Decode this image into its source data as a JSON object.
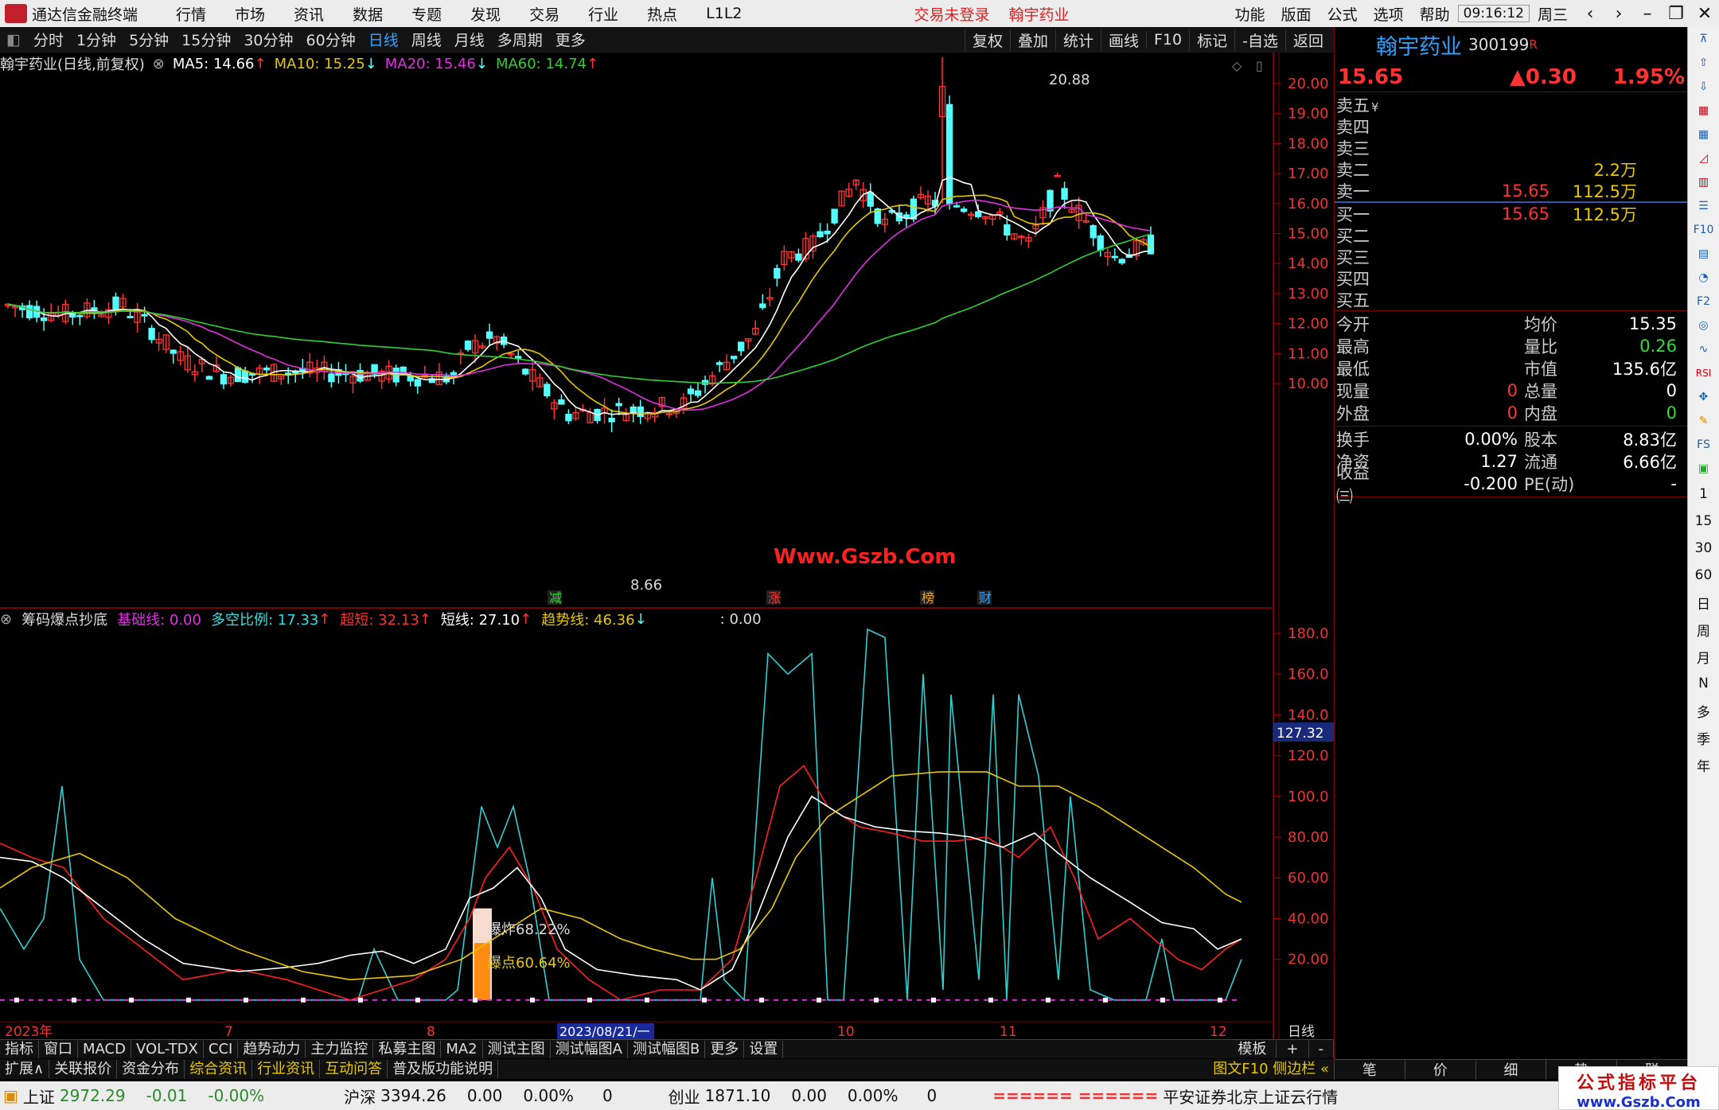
{
  "app": {
    "name": "通达信金融终端",
    "menus": [
      "行情",
      "市场",
      "资讯",
      "数据",
      "专题",
      "发现",
      "交易",
      "行业",
      "热点",
      "L1L2"
    ],
    "login_warn": "交易未登录",
    "title_stock": "翰宇药业",
    "rmenus": [
      "功能",
      "版面",
      "公式",
      "选项",
      "帮助"
    ],
    "time": "09:16:12",
    "weekday": "周三"
  },
  "periods": [
    "分时",
    "1分钟",
    "5分钟",
    "15分钟",
    "30分钟",
    "60分钟",
    "日线",
    "周线",
    "月线",
    "多周期",
    "更多"
  ],
  "selected_period": "日线",
  "toolbar_right": [
    "复权",
    "叠加",
    "统计",
    "画线",
    "F10",
    "标记",
    "-自选",
    "返回"
  ],
  "kline": {
    "title": "翰宇药业(日线,前复权)",
    "ma5": "MA5: 14.66",
    "ma10": "MA10: 15.25",
    "ma20": "MA20: 15.46",
    "ma60": "MA60: 14.74",
    "high_label": "20.88",
    "low_label": "8.66",
    "watermark": "Www.Gszb.Com",
    "markers": [
      "减",
      "涨",
      "榜",
      "财"
    ],
    "yticks": [
      "20.00",
      "19.00",
      "18.00",
      "17.00",
      "16.00",
      "15.00",
      "14.00",
      "13.00",
      "12.00",
      "11.00",
      "10.00"
    ]
  },
  "ind2": {
    "name": "筹码爆点抄底",
    "jcx": "基础线: 0.00",
    "dkbl": "多空比例: 17.33",
    "chd": "超短: 32.13",
    "dx": "短线: 27.10",
    "qsx": "趋势线: 46.36",
    "extra": ": 0.00",
    "label_a": "爆炸68.22%",
    "label_b": "爆点60.64%",
    "yticks": [
      "180.0",
      "160.0",
      "140.0",
      "120.0",
      "100.0",
      "80.00",
      "60.00",
      "40.00",
      "20.00"
    ],
    "cursor_val": "127.32"
  },
  "xaxis": {
    "year": "2023年",
    "m7": "7",
    "m8": "8",
    "m10": "10",
    "m11": "11",
    "m12": "12",
    "cursor_date": "2023/08/21/一",
    "period": "日线"
  },
  "tabs1": [
    "指标",
    "窗口",
    "MACD",
    "VOL-TDX",
    "CCI",
    "趋势动力",
    "主力监控",
    "私募主图",
    "MA2",
    "测试主图",
    "测试幅图A",
    "测试幅图B",
    "更多",
    "设置"
  ],
  "tabs1_right": [
    "模板",
    "+",
    "-"
  ],
  "tabs2": [
    "扩展∧",
    "关联报价",
    "资金分布",
    "综合资讯",
    "行业资讯",
    "互动问答",
    "普及版功能说明"
  ],
  "tabs2_right": "图文F10 侧边栏 «",
  "quote": {
    "name": "翰宇药业",
    "code": "300199",
    "r_mark": "R",
    "price": "15.65",
    "change": "▲0.30",
    "pct": "1.95%",
    "sells": [
      {
        "l": "卖五",
        "sym": "¥",
        "p": "",
        "v": ""
      },
      {
        "l": "卖四",
        "sym": "",
        "p": "",
        "v": ""
      },
      {
        "l": "卖三",
        "sym": "",
        "p": "",
        "v": ""
      },
      {
        "l": "卖二",
        "sym": "",
        "p": "",
        "v": "2.2万"
      },
      {
        "l": "卖一",
        "sym": "",
        "p": "15.65",
        "v": "112.5万"
      }
    ],
    "buys": [
      {
        "l": "买一",
        "p": "15.65",
        "v": "112.5万"
      },
      {
        "l": "买二",
        "p": "",
        "v": ""
      },
      {
        "l": "买三",
        "p": "",
        "v": ""
      },
      {
        "l": "买四",
        "p": "",
        "v": ""
      },
      {
        "l": "买五",
        "p": "",
        "v": ""
      }
    ],
    "stats1": [
      [
        "今开",
        "",
        "均价",
        "15.35"
      ],
      [
        "最高",
        "",
        "量比",
        "0.26"
      ],
      [
        "最低",
        "",
        "市值",
        "135.6亿"
      ],
      [
        "现量",
        "0",
        "总量",
        "0"
      ],
      [
        "外盘",
        "0",
        "内盘",
        "0"
      ]
    ],
    "stats2": [
      [
        "换手",
        "0.00%",
        "股本",
        "8.83亿"
      ],
      [
        "净资",
        "1.27",
        "流通",
        "6.66亿"
      ],
      [
        "收益㈢",
        "-0.200",
        "PE(动)",
        "-"
      ]
    ],
    "tabs": [
      "笔",
      "价",
      "细",
      "势",
      "联"
    ]
  },
  "sidebar_text": [
    "1",
    "15",
    "30",
    "60",
    "日",
    "周",
    "月",
    "N",
    "多",
    "季",
    "年"
  ],
  "status": {
    "sh_name": "上证",
    "sh_val": "2972.29",
    "sh_chg": "-0.01",
    "sh_pct": "-0.00%",
    "hs_name": "沪深",
    "hs_val": "3394.26",
    "hs_chg": "0.00",
    "hs_pct": "0.00%",
    "hs_vol": "0",
    "cy_name": "创业",
    "cy_val": "1871.10",
    "cy_chg": "0.00",
    "cy_pct": "0.00%",
    "cy_vol": "0",
    "bars": "====== ======",
    "broker": "平安证券北京上证云行情"
  },
  "brand": {
    "line1": "公式指标平台",
    "line2": "www.Gszb.Com"
  },
  "colors": {
    "up": "#ff3333",
    "down": "#54ffff",
    "ma5": "#ffffff",
    "ma10": "#e8c800",
    "ma20": "#e030e0",
    "ma60": "#30d030",
    "accent": "#3aa0ff"
  }
}
